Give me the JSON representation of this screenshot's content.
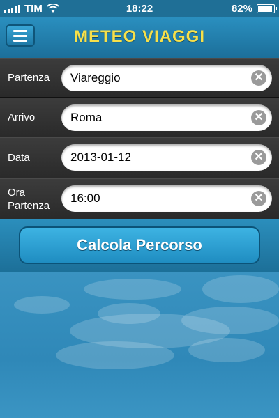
{
  "status_bar": {
    "carrier": "TIM",
    "time": "18:22",
    "battery": "82%",
    "battery_level": 0.82
  },
  "header": {
    "title": "METEO VIAGGI"
  },
  "form": {
    "rows": [
      {
        "label": "Partenza",
        "value": "Viareggio"
      },
      {
        "label": "Arrivo",
        "value": "Roma"
      },
      {
        "label": "Data",
        "value": "2013-01-12"
      },
      {
        "label": "Ora Partenza",
        "value": "16:00"
      }
    ]
  },
  "actions": {
    "calculate_label": "Calcola Percorso"
  },
  "icons": {
    "menu": "hamburger-icon",
    "clear": "clear-x-icon",
    "signal": "signal-icon",
    "wifi": "wifi-icon",
    "battery": "battery-icon"
  },
  "colors": {
    "header_blue": "#2a8fbf",
    "title_yellow": "#f7e04a",
    "row_dark": "#333333"
  }
}
